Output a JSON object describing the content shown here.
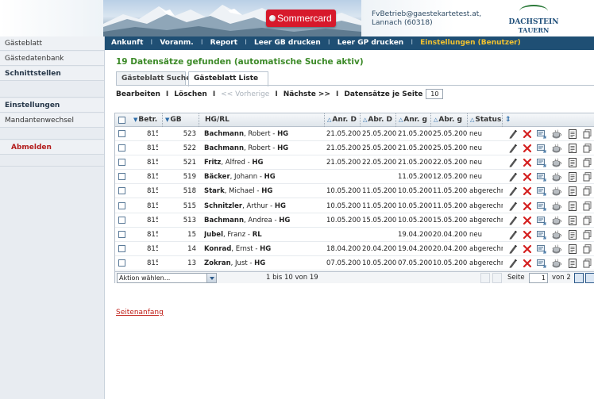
{
  "header": {
    "promo_label": "Sommercard",
    "account_email": "FvBetrieb@gaestekartetest.at,",
    "account_location": "Lannach (60318)",
    "logo_line1": "DACHSTEIN",
    "logo_line2": "TAUERN"
  },
  "sidebar": {
    "items": [
      {
        "label": "Gästeblatt",
        "style": "normal"
      },
      {
        "label": "Gästedatenbank",
        "style": "normal"
      },
      {
        "label": "Schnittstellen",
        "style": "bold"
      },
      {
        "label": "Einstellungen",
        "style": "bold"
      },
      {
        "label": "Mandantenwechsel",
        "style": "normal"
      },
      {
        "label": "Abmelden",
        "style": "red"
      }
    ]
  },
  "topnav": {
    "items": [
      "Ankunft",
      "Voranm.",
      "Report",
      "Leer GB drucken",
      "Leer GP drucken",
      "Einstellungen (Benutzer)"
    ],
    "separator": "I"
  },
  "headline": "19 Datensätze gefunden (automatische Suche aktiv)",
  "tabs": [
    {
      "label": "Gästeblatt Suche",
      "active": false
    },
    {
      "label": "Gästeblatt Liste",
      "active": true
    }
  ],
  "toolbar": {
    "edit": "Bearbeiten",
    "delete": "Löschen",
    "prev": "<< Vorherige",
    "next": "Nächste >>",
    "per_page_label": "Datensätze je Seite",
    "per_page_value": "10",
    "separator": "I"
  },
  "grid": {
    "columns": {
      "betr": "Betr.",
      "gb": "GB",
      "hgrl": "HG/RL",
      "anr1": "Anr. D",
      "abr1": "Abr. D",
      "anr2": "Anr. g",
      "abr2": "Abr. g",
      "status": "Status"
    },
    "rows": [
      {
        "betr": "815",
        "gb": "523",
        "name": "Bachmann",
        "first": ", Robert - ",
        "role": "HG",
        "anr1": "21.05.200",
        "abr1": "25.05.200",
        "anr2": "21.05.200",
        "abr2": "25.05.200",
        "status": "neu"
      },
      {
        "betr": "815",
        "gb": "522",
        "name": "Bachmann",
        "first": ", Robert - ",
        "role": "HG",
        "anr1": "21.05.200",
        "abr1": "25.05.200",
        "anr2": "21.05.200",
        "abr2": "25.05.200",
        "status": "neu"
      },
      {
        "betr": "815",
        "gb": "521",
        "name": "Fritz",
        "first": ", Alfred - ",
        "role": "HG",
        "anr1": "21.05.200",
        "abr1": "22.05.200",
        "anr2": "21.05.200",
        "abr2": "22.05.200",
        "status": "neu"
      },
      {
        "betr": "815",
        "gb": "519",
        "name": "Bäcker",
        "first": ", Johann - ",
        "role": "HG",
        "anr1": "",
        "abr1": "",
        "anr2": "11.05.200",
        "abr2": "12.05.200",
        "status": "neu"
      },
      {
        "betr": "815",
        "gb": "518",
        "name": "Stark",
        "first": ", Michael - ",
        "role": "HG",
        "anr1": "10.05.200",
        "abr1": "11.05.200",
        "anr2": "10.05.200",
        "abr2": "11.05.200",
        "status": "abgerechr"
      },
      {
        "betr": "815",
        "gb": "515",
        "name": "Schnitzler",
        "first": ", Arthur - ",
        "role": "HG",
        "anr1": "10.05.200",
        "abr1": "11.05.200",
        "anr2": "10.05.200",
        "abr2": "11.05.200",
        "status": "abgerechr"
      },
      {
        "betr": "815",
        "gb": "513",
        "name": "Bachmann",
        "first": ", Andrea - ",
        "role": "HG",
        "anr1": "10.05.200",
        "abr1": "15.05.200",
        "anr2": "10.05.200",
        "abr2": "15.05.200",
        "status": "abgerechr"
      },
      {
        "betr": "815",
        "gb": "15",
        "name": "Jubel",
        "first": ", Franz - ",
        "role": "RL",
        "anr1": "",
        "abr1": "",
        "anr2": "19.04.200",
        "abr2": "20.04.200",
        "status": "neu"
      },
      {
        "betr": "815",
        "gb": "14",
        "name": "Konrad",
        "first": ", Ernst - ",
        "role": "HG",
        "anr1": "18.04.200",
        "abr1": "20.04.200",
        "anr2": "19.04.200",
        "abr2": "20.04.200",
        "status": "abgerechr"
      },
      {
        "betr": "815",
        "gb": "13",
        "name": "Zokran",
        "first": ", Just - ",
        "role": "HG",
        "anr1": "07.05.200",
        "abr1": "10.05.200",
        "anr2": "07.05.200",
        "abr2": "10.05.200",
        "status": "abgerechr"
      }
    ],
    "row_actions": [
      "edit-pencil-icon",
      "delete-x-icon",
      "copy-card-icon",
      "tea-cup-icon",
      "document-icon",
      "duplicate-icon"
    ],
    "footer": {
      "action_select": "Aktion wählen...",
      "range_text": "1 bis 10 von 19",
      "page_label": "Seite",
      "page_value": "1",
      "page_total": "von 2"
    }
  },
  "footer_link": "Seitenanfang",
  "colors": {
    "nav_bg": "#1f4f74",
    "nav_active": "#f2c230",
    "headline": "#3c8a28",
    "promo": "#d7192b",
    "delete_red": "#d42020",
    "link_red": "#c0201a"
  }
}
